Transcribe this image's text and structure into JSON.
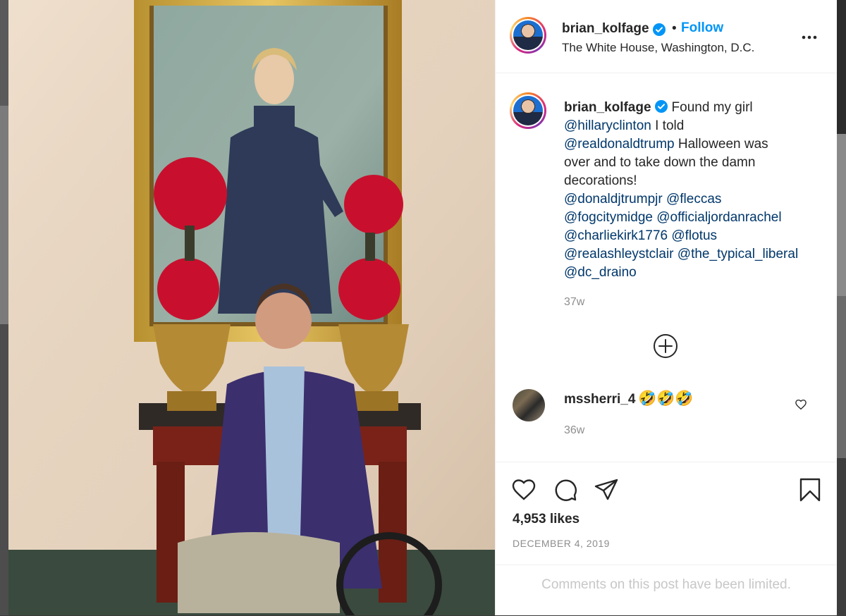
{
  "post": {
    "username": "brian_kolfage",
    "separator": "•",
    "follow_label": "Follow",
    "location": "The White House, Washington, D.C.",
    "more_icon": "more-options-icon",
    "caption": {
      "username": "brian_kolfage",
      "line1_text": "Found my girl",
      "line2_mention": "@hillaryclinton",
      "line2_text": " I told",
      "line3_mention": "@realdonaldtrump",
      "line3_text": " Halloween was",
      "line4_text": "over and to take down the damn",
      "line5_text": "decorations!",
      "line6_m1": "@donaldjtrumpjr",
      "line6_m2": "@fleccas",
      "line7_m1": "@fogcitymidge",
      "line7_m2": "@officialjordanrachel",
      "line8_m1": "@charliekirk1776",
      "line8_m2": "@flotus",
      "line9_m1": "@realashleystclair",
      "line9_m2": "@the_typical_liberal",
      "line10_m1": "@dc_draino",
      "age": "37w"
    },
    "comment": {
      "username": "mssherri_4",
      "text": "🤣🤣🤣",
      "age": "36w"
    },
    "likes": "4,953 likes",
    "date": "DECEMBER 4, 2019",
    "comments_limited": "Comments on this post have been limited.",
    "colors": {
      "link": "#0095f6",
      "mention": "#00376b",
      "muted": "#8e8e8e",
      "verified": "#0095f6"
    }
  }
}
